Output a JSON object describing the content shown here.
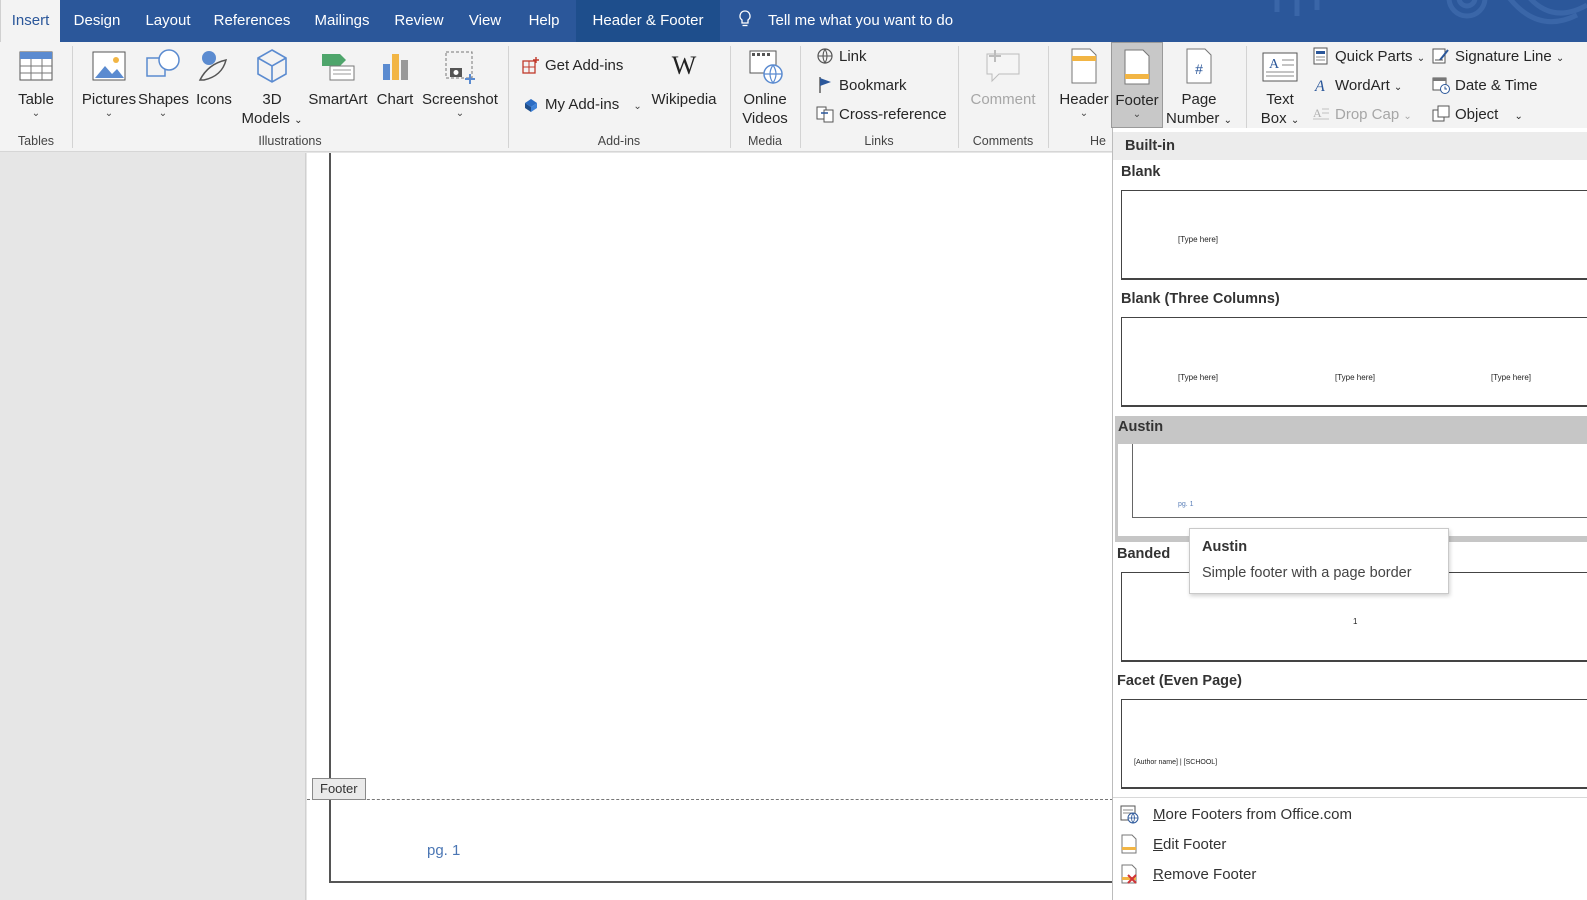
{
  "tabs": [
    {
      "label": "Insert"
    },
    {
      "label": "Design"
    },
    {
      "label": "Layout"
    },
    {
      "label": "References"
    },
    {
      "label": "Mailings"
    },
    {
      "label": "Review"
    },
    {
      "label": "View"
    },
    {
      "label": "Help"
    },
    {
      "label": "Header & Footer"
    }
  ],
  "tell_me": "Tell me what you want to do",
  "ribbon": {
    "tables": {
      "group": "Tables",
      "table": "Table"
    },
    "illustrations": {
      "group": "Illustrations",
      "pictures": "Pictures",
      "shapes": "Shapes",
      "icons": "Icons",
      "models_1": "3D",
      "models_2": "Models",
      "smartart": "SmartArt",
      "chart": "Chart",
      "screenshot": "Screenshot"
    },
    "addins": {
      "group": "Add-ins",
      "get": "Get Add-ins",
      "my": "My Add-ins",
      "wikipedia": "Wikipedia"
    },
    "media": {
      "group": "Media",
      "online_1": "Online",
      "online_2": "Videos"
    },
    "links": {
      "group": "Links",
      "link": "Link",
      "bookmark": "Bookmark",
      "crossref": "Cross-reference"
    },
    "comments": {
      "group": "Comments",
      "comment": "Comment"
    },
    "hf": {
      "group": "He",
      "header": "Header",
      "footer": "Footer",
      "page_1": "Page",
      "page_2": "Number"
    },
    "text": {
      "textbox_1": "Text",
      "textbox_2": "Box",
      "quick_parts": "Quick Parts",
      "wordart": "WordArt",
      "drop_cap": "Drop Cap",
      "signature": "Signature Line",
      "datetime": "Date & Time",
      "object": "Object"
    }
  },
  "document": {
    "footer_tag": "Footer",
    "page_number": "pg. 1"
  },
  "gallery": {
    "heading": "Built-in",
    "items": [
      {
        "title": "Blank",
        "samples": [
          "[Type here]"
        ]
      },
      {
        "title": "Blank (Three Columns)",
        "samples": [
          "[Type here]",
          "[Type here]",
          "[Type here]"
        ]
      },
      {
        "title": "Austin",
        "samples": [
          "pg. 1"
        ]
      },
      {
        "title": "Banded",
        "samples": [
          "1"
        ]
      },
      {
        "title": "Facet (Even Page)",
        "samples": [
          "[Author name] | [SCHOOL]"
        ]
      }
    ],
    "commands": [
      {
        "ul": "M",
        "rest": "ore Footers from Office.com"
      },
      {
        "ul": "E",
        "rest": "dit Footer"
      },
      {
        "ul": "R",
        "rest": "emove Footer"
      }
    ]
  },
  "tooltip": {
    "title": "Austin",
    "description": "Simple footer with a page border"
  },
  "colors": {
    "ribbon_blue": "#2b579a",
    "page_number_blue": "#4a76b4"
  }
}
